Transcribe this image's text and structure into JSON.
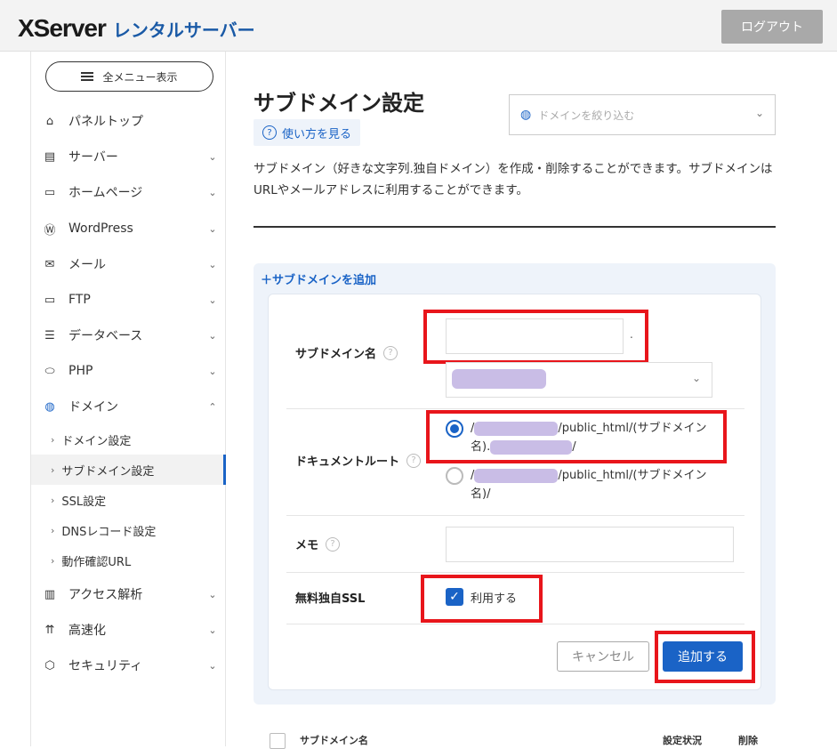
{
  "header": {
    "logo_main": "XServer",
    "logo_sub": "レンタルサーバー",
    "logout_label": "ログアウト"
  },
  "sidebar": {
    "menu_all_label": "全メニュー表示",
    "items": [
      {
        "label": "パネルトップ",
        "icon": "home-icon"
      },
      {
        "label": "サーバー",
        "icon": "server-icon"
      },
      {
        "label": "ホームページ",
        "icon": "window-icon"
      },
      {
        "label": "WordPress",
        "icon": "wordpress-icon"
      },
      {
        "label": "メール",
        "icon": "mail-icon"
      },
      {
        "label": "FTP",
        "icon": "monitor-icon"
      },
      {
        "label": "データベース",
        "icon": "database-icon"
      },
      {
        "label": "PHP",
        "icon": "php-icon"
      },
      {
        "label": "ドメイン",
        "icon": "globe-icon"
      }
    ],
    "domain_subitems": [
      "ドメイン設定",
      "サブドメイン設定",
      "SSL設定",
      "DNSレコード設定",
      "動作確認URL"
    ],
    "bottom_items": [
      {
        "label": "アクセス解析",
        "icon": "chart-icon"
      },
      {
        "label": "高速化",
        "icon": "speed-icon"
      },
      {
        "label": "セキュリティ",
        "icon": "shield-icon"
      }
    ]
  },
  "main": {
    "title": "サブドメイン設定",
    "help_label": "使い方を見る",
    "filter_placeholder": "ドメインを絞り込む",
    "description": "サブドメイン（好きな文字列.独自ドメイン）を作成・削除することができます。サブドメインはURLやメールアドレスに利用することができます。",
    "add_link": "＋サブドメインを追加"
  },
  "form": {
    "subdomain_label": "サブドメイン名",
    "subdomain_value": "",
    "subdomain_dot": ".",
    "docroot_label": "ドキュメントルート",
    "docroot_option1": "/            /public_html/(サブドメイン名).             /",
    "docroot_option1_prefix": "/",
    "docroot_option1_mid": "/public_html/(サブドメイン",
    "docroot_option1_line2a": "名).",
    "docroot_option1_line2b": "/",
    "docroot_option2_prefix": "/",
    "docroot_option2_mid": "/public_html/(サブドメイン",
    "docroot_option2_line2": "名)/",
    "memo_label": "メモ",
    "memo_value": "",
    "ssl_label": "無料独自SSL",
    "ssl_checkbox_label": "利用する",
    "ssl_checked": true,
    "cancel_label": "キャンセル",
    "add_label": "追加する"
  },
  "table": {
    "col_name": "サブドメイン名",
    "col_status": "設定状況",
    "col_delete": "削除"
  },
  "colors": {
    "accent": "#1a63c6",
    "highlight": "#e8151b",
    "redacted": "#c9bde6"
  }
}
